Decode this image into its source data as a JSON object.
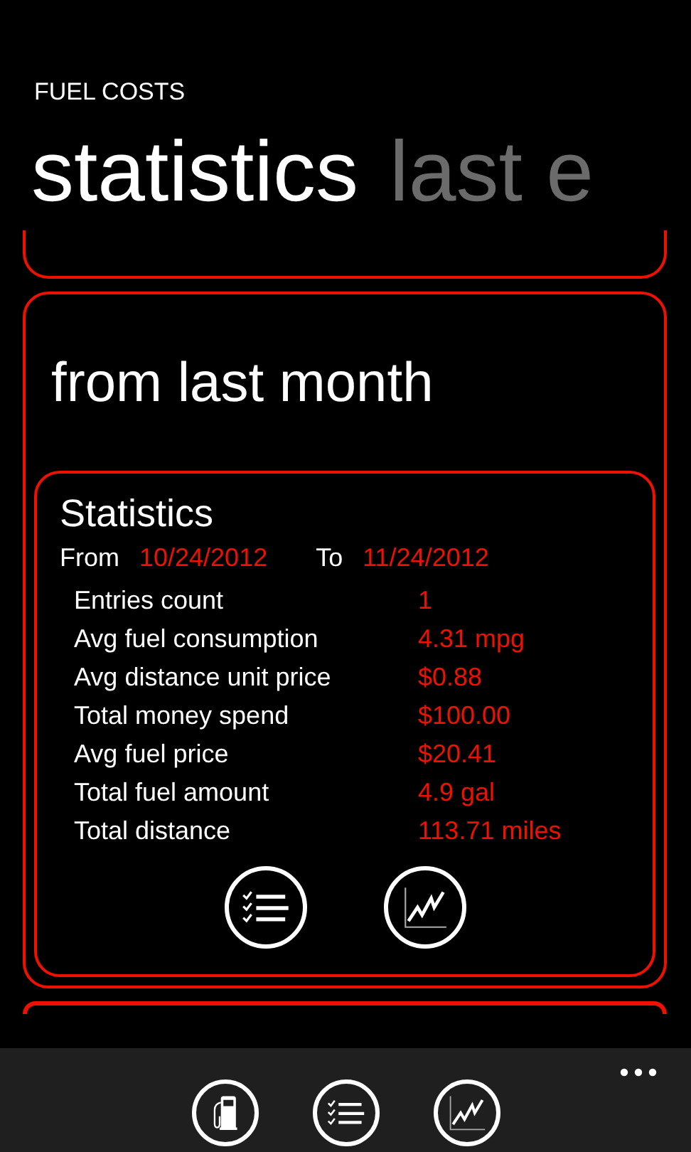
{
  "app_title": "FUEL COSTS",
  "pivot": [
    {
      "label": "statistics",
      "selected": true
    },
    {
      "label": "last e",
      "selected": false
    }
  ],
  "section": {
    "title": "from last month",
    "card": {
      "title": "Statistics",
      "from_label": "From",
      "from_date": "10/24/2012",
      "to_label": "To",
      "to_date": "11/24/2012",
      "rows": [
        {
          "label": "Entries count",
          "value": "1"
        },
        {
          "label": "Avg fuel consumption",
          "value": "4.31 mpg"
        },
        {
          "label": "Avg distance unit price",
          "value": "$0.88"
        },
        {
          "label": "Total money spend",
          "value": "$100.00"
        },
        {
          "label": "Avg fuel price",
          "value": "$20.41"
        },
        {
          "label": "Total fuel amount",
          "value": "4.9 gal"
        },
        {
          "label": "Total distance",
          "value": "113.71 miles"
        }
      ],
      "actions": [
        {
          "kind": "list"
        },
        {
          "kind": "chart"
        }
      ]
    }
  },
  "app_bar": {
    "buttons": [
      {
        "kind": "fuel"
      },
      {
        "kind": "list"
      },
      {
        "kind": "chart"
      }
    ]
  }
}
